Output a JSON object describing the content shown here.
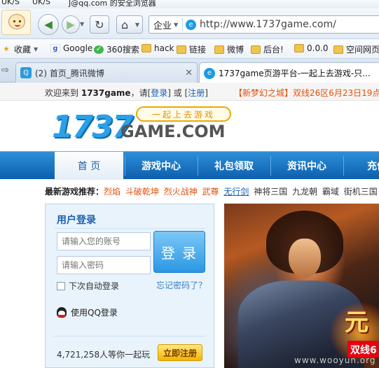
{
  "titlebar": {
    "fragment_1": "UK/S",
    "fragment_2": "UK/S",
    "fragment_3": "J@qq.com 的安全浏览器"
  },
  "navbar": {
    "address_label": "企业",
    "url": "http://www.1737game.com/"
  },
  "bookmarks": [
    {
      "label": "收藏",
      "icon": "star-icon"
    },
    {
      "label": "Google",
      "icon": "google-icon"
    },
    {
      "label": "360搜索",
      "icon": "360-search-icon"
    },
    {
      "label": "hack",
      "icon": "folder-icon"
    },
    {
      "label": "链接",
      "icon": "folder-icon"
    },
    {
      "label": "微博",
      "icon": "folder-icon"
    },
    {
      "label": "后台!",
      "icon": "folder-icon"
    },
    {
      "label": "0.0.0",
      "icon": "folder-icon"
    },
    {
      "label": "空间网页",
      "icon": "folder-icon"
    }
  ],
  "tabs": [
    {
      "label": "(2) 首页_腾讯微博",
      "icon": "weibo-icon",
      "active": false
    },
    {
      "label": "1737game页游平台-一起上去游戏-只...",
      "icon": "browser-e-icon",
      "active": true
    }
  ],
  "infostrip": {
    "welcome_prefix": "欢迎来到",
    "site_name": "1737game",
    "please": "，请[",
    "login": "登录",
    "or": "] 或 [",
    "register": "注册",
    "close": "]",
    "announcement": "【新梦幻之城】双线26区6月23日19点火"
  },
  "logo": {
    "numbers": "1737",
    "game": "GAME.COM",
    "slogan": "一起上去游戏"
  },
  "mainnav": {
    "items": [
      "首 页",
      "游戏中心",
      "礼包领取",
      "资讯中心",
      "充值"
    ]
  },
  "recommend": {
    "label": "最新游戏推荐：",
    "games": [
      "烈焰",
      "斗破乾坤",
      "烈火战神",
      "武尊",
      "无行剑",
      "神将三国",
      "九龙朝",
      "霸域",
      "街机三国",
      "醉西"
    ]
  },
  "login": {
    "title": "用户登录",
    "username_placeholder": "请输入您的账号",
    "password_placeholder": "请输入密码",
    "login_button": "登 录",
    "remember": "下次自动登录",
    "forgot": "忘记密码了？",
    "qq_login": "使用QQ登录",
    "player_count": "4,721,258人等你一起玩",
    "register_button": "立即注册"
  },
  "banner": {
    "title_char": "元",
    "tag": "双线6"
  },
  "watermark": "www.wooyun.org"
}
